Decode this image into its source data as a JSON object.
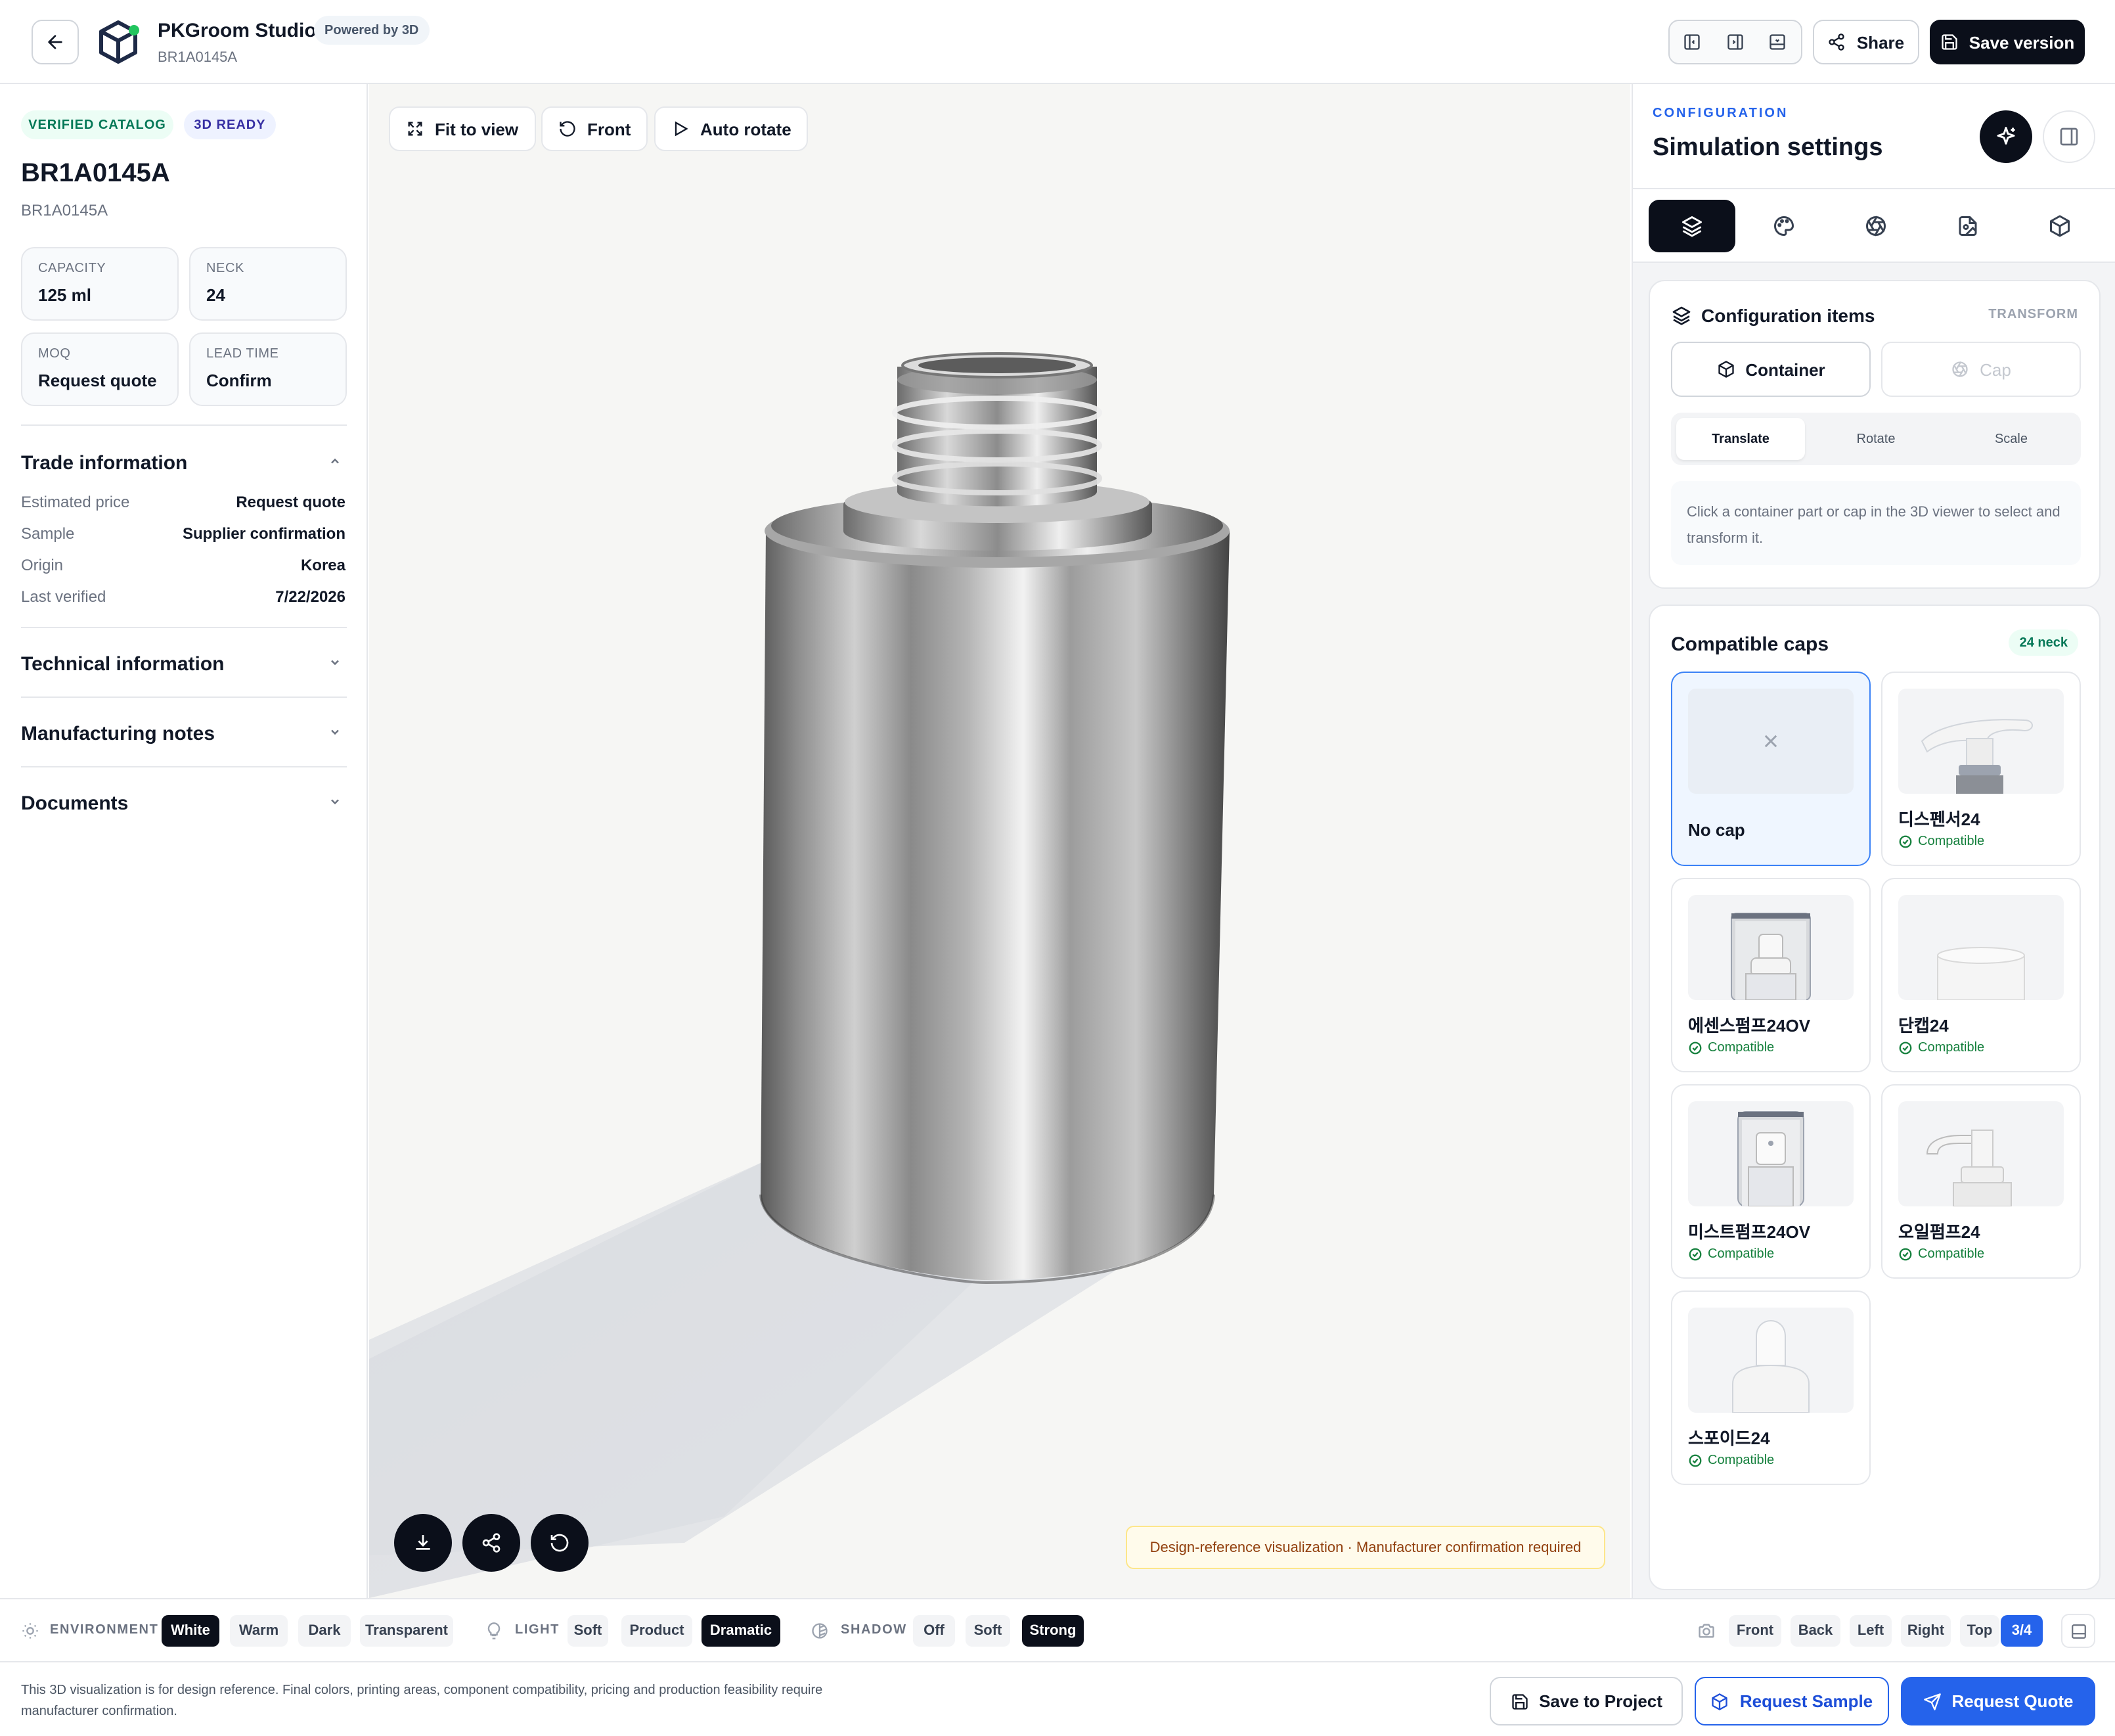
{
  "header": {
    "app_title": "PKGroom Studio",
    "powered_badge": "Powered by 3D",
    "product_code": "BR1A0145A",
    "share_label": "Share",
    "save_version_label": "Save version"
  },
  "left": {
    "badges": [
      "VERIFIED CATALOG",
      "3D READY"
    ],
    "title": "BR1A0145A",
    "subtitle": "BR1A0145A",
    "specs": [
      {
        "label": "CAPACITY",
        "value": "125 ml"
      },
      {
        "label": "NECK",
        "value": "24"
      },
      {
        "label": "MOQ",
        "value": "Request quote"
      },
      {
        "label": "LEAD TIME",
        "value": "Confirm"
      }
    ],
    "trade": {
      "title": "Trade information",
      "rows": [
        {
          "label": "Estimated price",
          "value": "Request quote"
        },
        {
          "label": "Sample",
          "value": "Supplier confirmation"
        },
        {
          "label": "Origin",
          "value": "Korea"
        },
        {
          "label": "Last verified",
          "value": "7/22/2026"
        }
      ]
    },
    "sections": [
      "Technical information",
      "Manufacturing notes",
      "Documents"
    ]
  },
  "viewer": {
    "fit_label": "Fit to view",
    "front_label": "Front",
    "auto_rotate_label": "Auto rotate",
    "notice": "Design-reference visualization · Manufacturer confirmation required"
  },
  "right": {
    "eyebrow": "CONFIGURATION",
    "title": "Simulation settings",
    "tab_icons": [
      "layers-icon",
      "palette-icon",
      "aperture-icon",
      "file-image-icon",
      "box-icon"
    ],
    "config": {
      "title": "Configuration items",
      "tag": "TRANSFORM",
      "container_label": "Container",
      "cap_label": "Cap",
      "modes": [
        "Translate",
        "Rotate",
        "Scale"
      ],
      "active_mode": "Translate",
      "hint": "Click a container part or cap in the 3D viewer to select and transform it."
    },
    "caps": {
      "title": "Compatible caps",
      "neck_badge": "24 neck",
      "compatible_label": "Compatible",
      "no_cap_label": "No cap",
      "items": [
        "디스펜서24",
        "에센스펌프24OV",
        "단캡24",
        "미스트펌프24OV",
        "오일펌프24",
        "스포이드24"
      ]
    }
  },
  "toolbar": {
    "environment_label": "ENVIRONMENT",
    "environment_options": [
      "White",
      "Warm",
      "Dark",
      "Transparent"
    ],
    "environment_selected": "White",
    "light_label": "LIGHT",
    "light_options": [
      "Soft",
      "Product",
      "Dramatic"
    ],
    "light_selected": "Dramatic",
    "shadow_label": "SHADOW",
    "shadow_options": [
      "Off",
      "Soft",
      "Strong"
    ],
    "shadow_selected": "Strong",
    "view_options": [
      "Front",
      "Back",
      "Left",
      "Right",
      "Top",
      "3/4"
    ],
    "view_selected": "3/4"
  },
  "footer": {
    "disclaimer": "This 3D visualization is for design reference. Final colors, printing areas, component compatibility, pricing and production feasibility require manufacturer confirmation.",
    "save_project_label": "Save to Project",
    "request_sample_label": "Request Sample",
    "request_quote_label": "Request Quote"
  },
  "colors": {
    "primary_dark": "#0b0f1a",
    "accent_blue": "#2563eb",
    "success_green": "#15803d",
    "notice_bg": "#fffbeb"
  }
}
